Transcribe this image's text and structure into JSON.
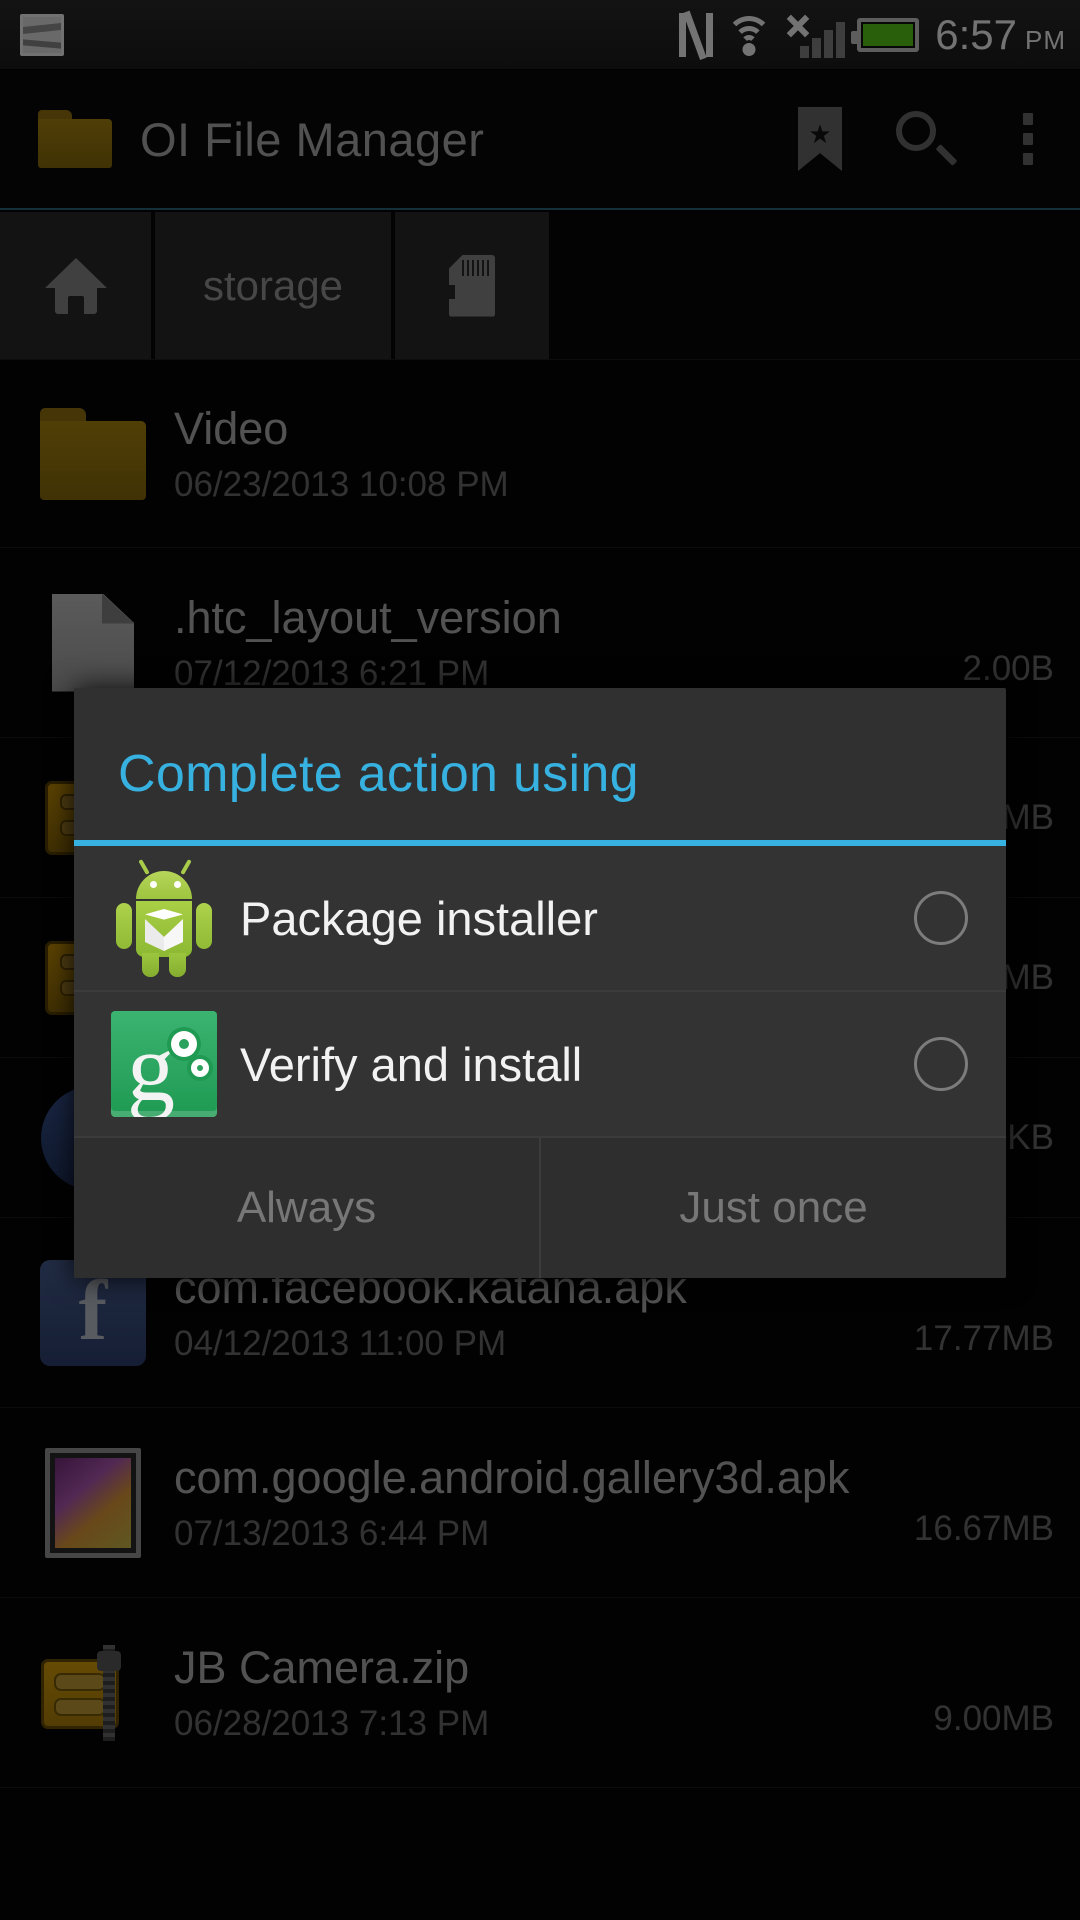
{
  "status_bar": {
    "icons": [
      "screenshot-icon",
      "nfc-icon",
      "wifi-icon",
      "signal-icon-no-service",
      "battery-icon"
    ],
    "time": "6:57",
    "am_pm": "PM"
  },
  "action_bar": {
    "app_icon": "folder-icon",
    "title": "OI File Manager",
    "buttons": [
      {
        "name": "bookmark-icon"
      },
      {
        "name": "search-icon"
      },
      {
        "name": "overflow-menu-icon"
      }
    ]
  },
  "breadcrumb": {
    "accent_color": "#2e6e80",
    "items": [
      {
        "type": "icon",
        "icon": "home-icon",
        "label": ""
      },
      {
        "type": "text",
        "icon": "",
        "label": "storage"
      },
      {
        "type": "icon",
        "icon": "sd-card-icon",
        "label": ""
      }
    ]
  },
  "file_list": [
    {
      "icon": "folder-icon",
      "name": "Video",
      "date": "06/23/2013 10:08 PM",
      "size": ""
    },
    {
      "icon": "file-icon",
      "name": ".htc_layout_version",
      "date": "07/12/2013 6:21 PM",
      "size": "2.00B"
    },
    {
      "icon": "zip-icon",
      "name": "",
      "date": "",
      "size": "MB"
    },
    {
      "icon": "zip-icon",
      "name": "",
      "date": "",
      "size": "MB"
    },
    {
      "icon": "blue-app-icon",
      "name": "",
      "date": "",
      "size": "KB"
    },
    {
      "icon": "facebook-icon",
      "name": "com.facebook.katana.apk",
      "date": "04/12/2013 11:00 PM",
      "size": "17.77MB"
    },
    {
      "icon": "gallery-icon",
      "name": "com.google.android.gallery3d.apk",
      "date": "07/13/2013 6:44 PM",
      "size": "16.67MB"
    },
    {
      "icon": "zip-icon",
      "name": "JB Camera.zip",
      "date": "06/28/2013 7:13 PM",
      "size": "9.00MB"
    }
  ],
  "dialog": {
    "title": "Complete action using",
    "title_color": "#36b1e0",
    "options": [
      {
        "icon": "android-package-installer-icon",
        "label": "Package installer",
        "selected": false
      },
      {
        "icon": "google-verify-icon",
        "label": "Verify and install",
        "selected": false
      }
    ],
    "buttons": [
      {
        "label": "Always",
        "enabled": false
      },
      {
        "label": "Just once",
        "enabled": false
      }
    ]
  }
}
